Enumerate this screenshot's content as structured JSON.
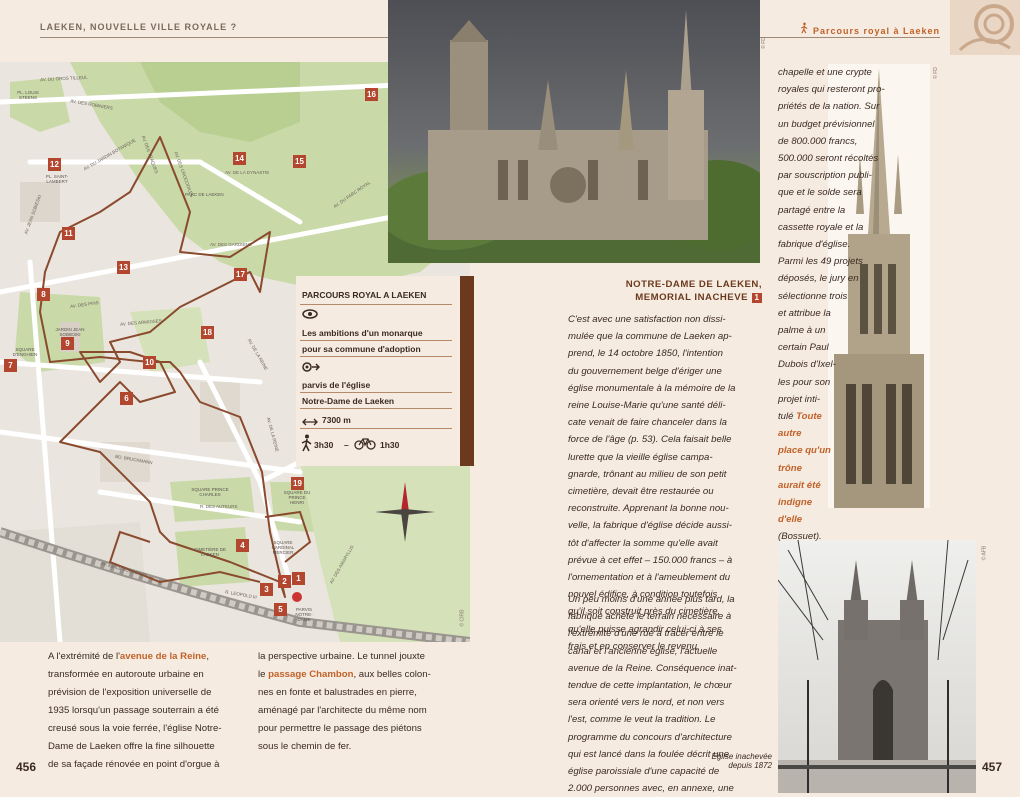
{
  "left_page": {
    "running_head": "LAEKEN, NOUVELLE VILLE ROYALE ?",
    "page_number": "456",
    "map_credit": "© CIRB",
    "map": {
      "markers": [
        "1",
        "2",
        "3",
        "4",
        "5",
        "6",
        "7",
        "8",
        "9",
        "10",
        "11",
        "12",
        "13",
        "14",
        "15",
        "16",
        "17",
        "18",
        "19"
      ],
      "streets": [
        "AV. DU GROS TILLEUL",
        "AV. DES ROBINIERS",
        "AV. DU PARC ROYAL",
        "AV. DES TRAQUES",
        "AV. DES CROCODILES",
        "AV. DU JARDIN BOTANIQUE",
        "AV. JEAN SOBIESKI",
        "AV. DE LA DYNASTIE",
        "AV. DES TRIANONS",
        "AV. DU PARC ROYAL",
        "AV. DES GARDIENS",
        "AV. DES PINS",
        "AV. DES ARMOISES",
        "AV. DE MEYSSE",
        "AV. DES CEDRES",
        "DR. DE L'ARAIGNEE",
        "AV. DE LA REINE",
        "AV. DE LA REINE",
        "PARVIS N.-D.",
        "RUE MONTAGNE",
        "BD. BRUCKMANN",
        "AV. DES AMARYLLIS",
        "AV. DU CIMETIERE",
        "BD. DE LA REINE",
        "PL. DE LA REINE",
        "R. DES AUTEURS",
        "AV. EMILE BOCKSTAEL",
        "RUE MARIE-CHRISTINE",
        "R. LEOPOLD III",
        "AV. DE LAEKEN"
      ],
      "places": {
        "parc_laeken": "PARC DE LAEKEN",
        "pl_louis": "PL. LOUIS STEENS",
        "saint_lambert": "PL. SAINT-LAMBERT",
        "square_prince": "SQUARE PRINCE CHARLES",
        "jardin": "JARDIN JEAN SOBIESKI",
        "square_ste": "SQUARE D'ENGHIEN",
        "square_jean": "SQUARE DU PRINCE HENRI",
        "cimetiere": "CIMETIÈRE DE LAEKEN",
        "square_cardinal": "SQUARE CARDINAL MERCIER",
        "parvis": "PARVIS NOTRE-DAME"
      }
    },
    "route_panel": {
      "title": "PARCOURS ROYAL A LAEKEN",
      "eye_icon": "eye-icon",
      "theme_line1": "Les ambitions d'un monarque",
      "theme_line2": "pour sa commune d'adoption",
      "start_icon": "start-arrow-icon",
      "start_line1": "parvis de l'église",
      "start_line2": "Notre-Dame de Laeken",
      "distance": "7300 m",
      "walk_time": "3h30",
      "dash": "–",
      "bike_time": "1h30",
      "accent_color": "#6b3a1e"
    },
    "body_col1": [
      {
        "text": "A l'extrémité de l'",
        "hl": "avenue de la Reine",
        "rest": ","
      },
      {
        "text": "transformée en autoroute urbaine en"
      },
      {
        "text": "prévision de l'exposition universelle de"
      },
      {
        "text": "1935 lorsqu'un passage souterrain a été"
      },
      {
        "text": "creusé sous la voie ferrée, l'église Notre-"
      },
      {
        "text": "Dame de Laeken offre la fine silhouette"
      },
      {
        "text": "de sa façade rénovée en point d'orgue à"
      }
    ],
    "body_col2": [
      {
        "text": "la perspective urbaine. Le tunnel jouxte"
      },
      {
        "text": "le ",
        "hl": "passage Chambon",
        "rest": ", aux belles colon-"
      },
      {
        "text": "nes en fonte et balustrades en pierre,"
      },
      {
        "text": "aménagé par l'architecte du même nom"
      },
      {
        "text": "pour permettre le passage des piétons"
      },
      {
        "text": "sous le chemin de fer."
      }
    ]
  },
  "right_page": {
    "running_head": "Parcours royal à Laeken",
    "page_number": "457",
    "photo_credit_top": "© FD",
    "photo_credit_right": "© FD",
    "photo_credit_bottom": "© AFB",
    "article_title_line1": "NOTRE-DAME DE LAEKEN,",
    "article_title_line2": "MEMORIAL INACHEVE",
    "article_number": "1",
    "article_lines": [
      "C'est avec une satisfaction non dissi-",
      "mulée que la commune de Laeken ap-",
      "prend, le 14 octobre 1850, l'intention",
      "du gouvernement belge d'ériger une",
      "église monumentale à la mémoire de la",
      "reine Louise-Marie qu'une santé déli-",
      "cate venait de faire chanceler dans la",
      "force de l'âge (p. 53). Cela faisait belle",
      "lurette que la vieille église campa-",
      "gnarde, trônant au milieu de son petit",
      "cimetière, devait être restaurée ou",
      "reconstruite. Apprenant la bonne nou-",
      "velle, la fabrique d'église décide aussi-",
      "tôt d'affecter la somme qu'elle avait",
      "prévue à cet effet – 150.000 francs – à",
      "l'ornementation et à l'ameublement du",
      "nouvel édifice, à condition toutefois",
      "qu'il soit construit près du cimetière,",
      "qu'elle puisse agrandir celui-ci à ses",
      "frais et en conserver le revenu."
    ],
    "article_lines_2": [
      "Un peu moins d'une année plus tard, la",
      "fabrique achète le terrain nécessaire à",
      "l'extrémité d'une rue à tracer entre le",
      "canal et l'ancienne église, l'actuelle",
      "avenue de la Reine. Conséquence inat-",
      "tendue de cette implantation, le chœur",
      "sera orienté vers le nord, et non vers",
      "l'est, comme le veut la tradition. Le",
      "programme du concours d'architecture",
      "qui est lancé dans la foulée décrit une",
      "église paroissiale d'une capacité de",
      "2.000 personnes avec, en annexe, une"
    ],
    "side_col": [
      "chapelle et une crypte",
      "royales qui resteront pro-",
      "priétés de la nation. Sur",
      "un budget prévisionnel",
      "de 800.000 francs,",
      "500.000 seront récoltés",
      "par souscription publi-",
      "que et le solde sera",
      "partagé entre la",
      "cassette royale et la",
      "fabrique d'église.",
      "Parmi les 49 projets",
      "déposés, le jury en",
      "sélectionne trois",
      "et attribue la",
      "palme à un",
      "certain Paul",
      "Dubois d'Ixel-",
      "les pour son",
      "projet inti-",
      "tulé"
    ],
    "side_highlight": [
      "Toute",
      "autre",
      "place qu'un",
      "trône",
      "aurait été",
      "indigne",
      "d'elle"
    ],
    "side_source": "(Bossuet).",
    "page_ref": "(p. 53)",
    "caption_line1": "Eglise inachevée",
    "caption_line2": "depuis 1872",
    "highlight_color": "#c0622a"
  }
}
